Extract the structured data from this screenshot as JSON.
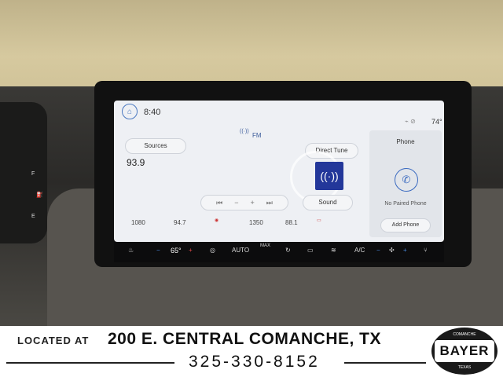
{
  "screen": {
    "clock": "8:40",
    "outside_temp": "74°",
    "band": "FM",
    "sources_label": "Sources",
    "frequency": "93.9",
    "direct_tune_label": "Direct Tune",
    "sound_label": "Sound",
    "presets": [
      "1080",
      "94.7",
      "1350",
      "88.1"
    ]
  },
  "phone": {
    "title": "Phone",
    "status": "No Paired Phone",
    "add_label": "Add Phone"
  },
  "climate": {
    "temperature": "65°",
    "auto_label": "AUTO",
    "max_label": "MAX",
    "ac_label": "A/C"
  },
  "banner": {
    "located_at": "LOCATED AT",
    "address": "200 E. CENTRAL COMANCHE, TX",
    "phone": "325-330-8152",
    "logo_text": "BAYER",
    "logo_top": "COMANCHE",
    "logo_bottom": "TEXAS"
  },
  "icons": {
    "home": "home-icon",
    "broadcast": "broadcast-icon",
    "phone": "phone-icon",
    "fan": "fan-icon"
  },
  "colors": {
    "accent": "#3a6ac0",
    "station_art": "#23379a"
  }
}
